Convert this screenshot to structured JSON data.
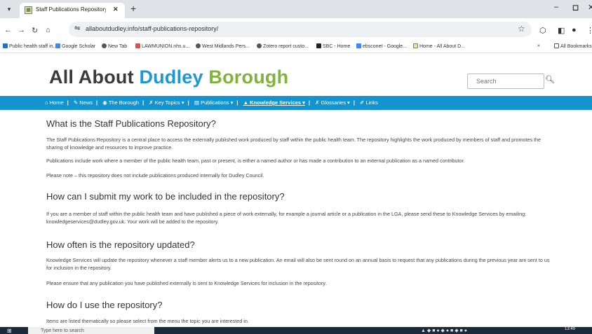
{
  "browser": {
    "tab_title": "Staff Publications Repository - I",
    "address": "allaboutdudley.info/staff-publications-repository/",
    "bookmarks": [
      "Public health staff in...",
      "Google Scholar",
      "New Tab",
      "LAWMUNION.nhs.u...",
      "West Midlands Pers...",
      "Zotero report custo...",
      "SBC - Home",
      "ebsconet - Google...",
      "Home - All About D..."
    ],
    "all_bookmarks": "All Bookmarks"
  },
  "site": {
    "logo": {
      "part1": "All About ",
      "part2": "Dudley ",
      "part3": "Borough"
    },
    "search_placeholder": "Search",
    "nav": [
      "Home",
      "News",
      "The Borough",
      "Key Topics",
      "Publications",
      "Knowledge Services",
      "Glossaries",
      "Links"
    ]
  },
  "content": {
    "sections": [
      {
        "heading": "What is the Staff Publications Repository?",
        "paragraphs": [
          "The Staff Publications Repository is a central place to access the externally published work produced by staff within the public health team. The repository highlights the work produced by members of staff and promotes the sharing of knowledge and resources to improve practice.",
          "Publications include work where a member of the public health team, past or present, is either a named author or has made a contribution to an external publication as a named contributor.",
          "Please note – this repository does not include publications produced internally for Dudley Council."
        ]
      },
      {
        "heading": "How can I submit my work to be included in the repository?",
        "paragraphs": [
          "If you are a member of staff within the public health team and have published a piece of work externally, for example a journal article or a publication in the LGA, please send these to Knowledge Services by emailing: knowledgeservices@dudley.gov.uk. Your work will be added to the repository."
        ]
      },
      {
        "heading": "How often is the repository updated?",
        "paragraphs": [
          "Knowledge Services will update the repository whenever a staff member alerts us to a new publication. An email will also be sent round on an annual basis to request that any publications during the previous year are sent to us for inclusion in the repository.",
          "Please ensure that any publication you have published externally is sent to Knowledge Services for inclusion in the repository."
        ]
      },
      {
        "heading": "How do I use the repository?",
        "paragraphs": [
          "Items are listed thematically so please select from the menu the topic you are interested in."
        ]
      }
    ]
  },
  "taskbar": {
    "search_placeholder": "Type here to search",
    "clock": "13:49"
  }
}
